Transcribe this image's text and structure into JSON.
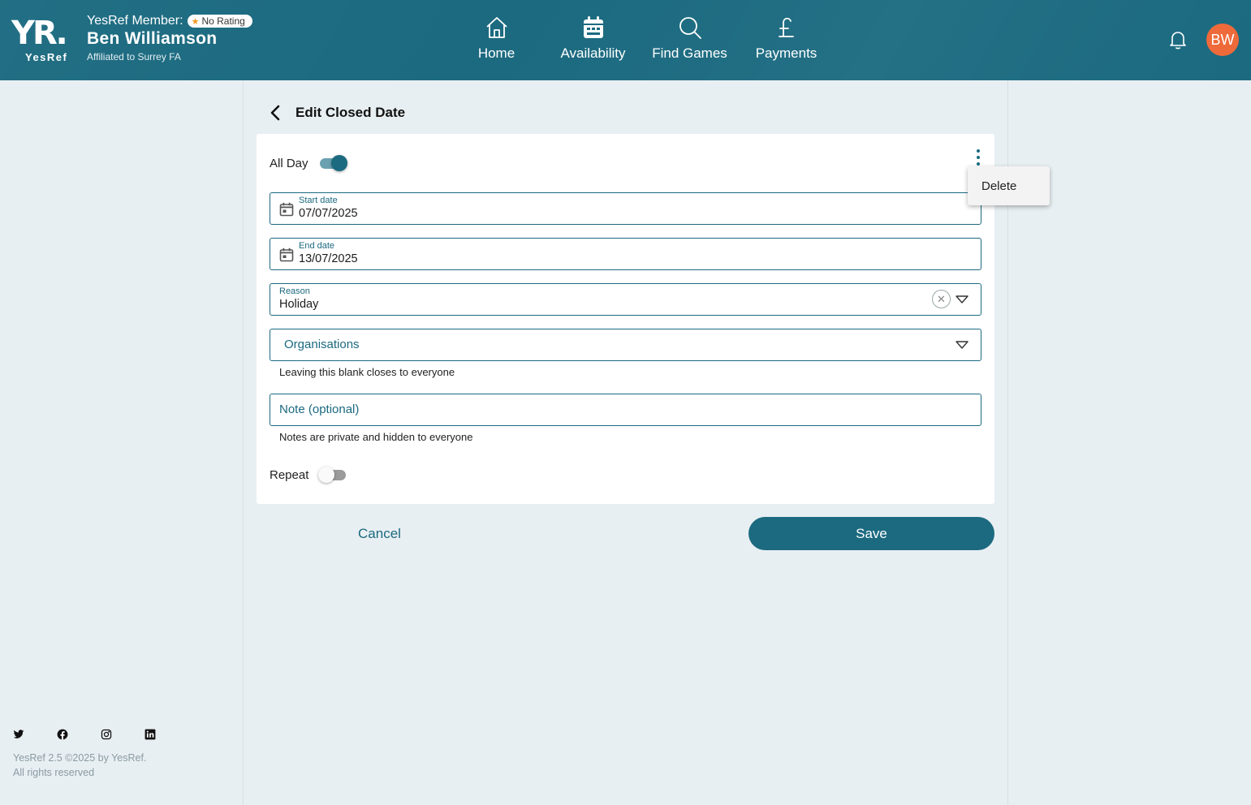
{
  "header": {
    "logo_mark": "YR.",
    "logo_text": "YesRef",
    "member_label": "YesRef Member:",
    "rating_badge": "No Rating",
    "user_name": "Ben Williamson",
    "affiliation": "Affiliated to Surrey FA",
    "avatar_initials": "BW",
    "nav": [
      {
        "label": "Home",
        "icon": "home-icon"
      },
      {
        "label": "Availability",
        "icon": "calendar-icon"
      },
      {
        "label": "Find Games",
        "icon": "search-icon"
      },
      {
        "label": "Payments",
        "icon": "pound-icon"
      }
    ]
  },
  "page": {
    "title": "Edit Closed Date"
  },
  "form": {
    "all_day_label": "All Day",
    "all_day_on": true,
    "start_date_label": "Start date",
    "start_date_value": "07/07/2025",
    "end_date_label": "End date",
    "end_date_value": "13/07/2025",
    "reason_label": "Reason",
    "reason_value": "Holiday",
    "organisations_placeholder": "Organisations",
    "organisations_helper": "Leaving this blank closes to everyone",
    "note_placeholder": "Note (optional)",
    "note_helper": "Notes are private and hidden to everyone",
    "repeat_label": "Repeat",
    "repeat_on": false
  },
  "menu": {
    "delete_label": "Delete"
  },
  "actions": {
    "cancel_label": "Cancel",
    "save_label": "Save"
  },
  "footer": {
    "version_line": "YesRef 2.5 ©2025 by YesRef.",
    "rights_line": "All rights reserved",
    "socials": [
      "twitter-icon",
      "facebook-icon",
      "instagram-icon",
      "linkedin-icon"
    ]
  },
  "colors": {
    "brand": "#1b6a80",
    "avatar": "#ef6a3a",
    "background": "#e8eff2"
  }
}
